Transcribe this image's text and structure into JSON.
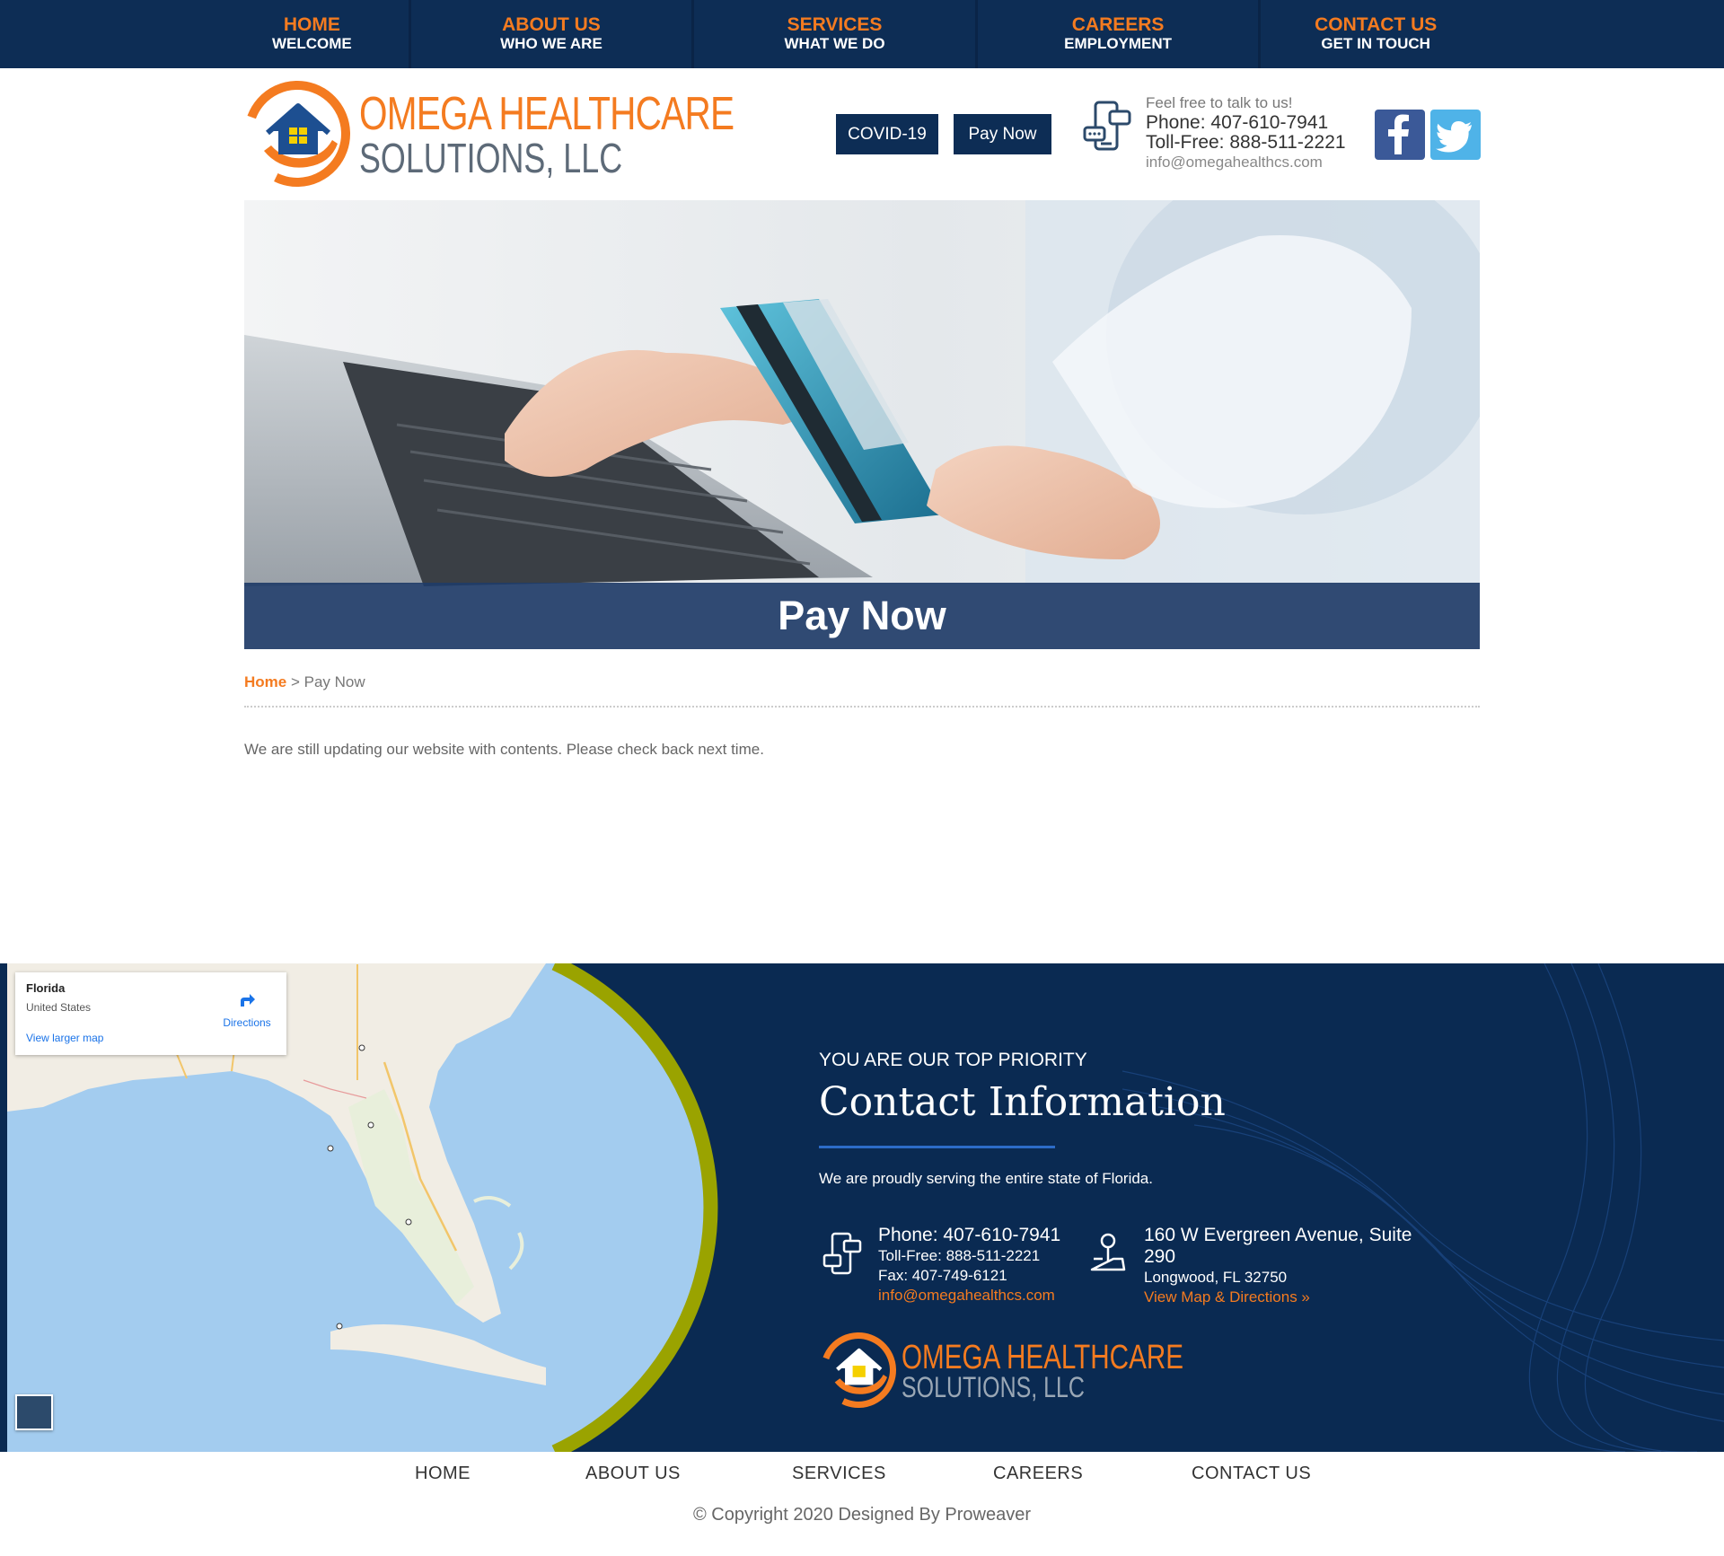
{
  "nav": [
    {
      "label": "HOME",
      "sub": "WELCOME"
    },
    {
      "label": "ABOUT US",
      "sub": "WHO WE ARE"
    },
    {
      "label": "SERVICES",
      "sub": "WHAT WE DO"
    },
    {
      "label": "CAREERS",
      "sub": "EMPLOYMENT"
    },
    {
      "label": "CONTACT US",
      "sub": "GET IN TOUCH"
    }
  ],
  "logo": {
    "line1": "OMEGA HEALTHCARE",
    "line2": "SOLUTIONS, LLC"
  },
  "header": {
    "covid_label": "COVID-19",
    "pay_label": "Pay Now",
    "tagline": "Feel free to talk to us!",
    "phone": "Phone: 407-610-7941",
    "tollfree": "Toll-Free: 888-511-2221",
    "email": "info@omegahealthcs.com"
  },
  "social": {
    "facebook": "facebook-icon",
    "twitter": "twitter-icon"
  },
  "banner": {
    "title": "Pay Now"
  },
  "breadcrumb": {
    "home": "Home",
    "separator": ">",
    "current": "Pay Now"
  },
  "content": {
    "text": "We are still updating our website with contents. Please check back next time."
  },
  "map": {
    "place": "Florida",
    "country": "United States",
    "directions": "Directions",
    "larger": "View larger map"
  },
  "footer": {
    "kicker": "YOU ARE OUR TOP PRIORITY",
    "title": "Contact Information",
    "lead": "We are proudly serving the entire state of Florida.",
    "phone": "Phone: 407-610-7941",
    "tollfree": "Toll-Free: 888-511-2221",
    "fax": "Fax: 407-749-6121",
    "email": "info@omegahealthcs.com",
    "address1": "160 W Evergreen Avenue, Suite 290",
    "address2": "Longwood, FL 32750",
    "map_link": "View Map & Directions »"
  },
  "bottom_nav": [
    "HOME",
    "ABOUT US",
    "SERVICES",
    "CAREERS",
    "CONTACT US"
  ],
  "copyright": "© Copyright 2020 Designed By Proweaver",
  "colors": {
    "navy": "#0d2d55",
    "orange": "#f47b20",
    "footer_bg": "#0a2a52",
    "accent_blue": "#2d6cc7"
  }
}
